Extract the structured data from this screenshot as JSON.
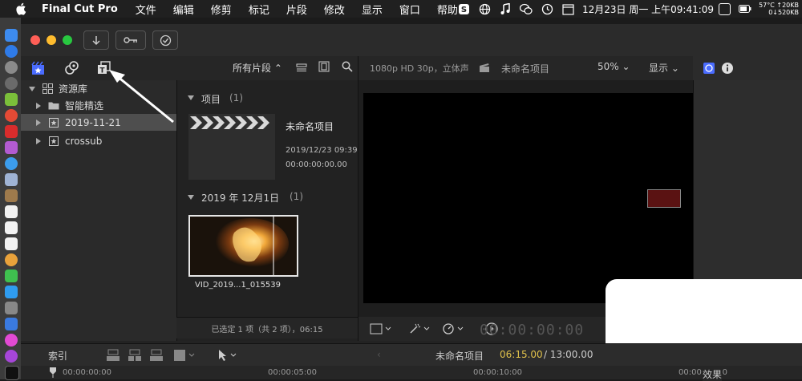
{
  "menubar": {
    "app": "Final Cut Pro",
    "items": [
      "文件",
      "编辑",
      "修剪",
      "标记",
      "片段",
      "修改",
      "显示",
      "窗口",
      "帮助"
    ],
    "clock": "12月23日 周一 上午09:41:09",
    "stats_top": "57°C ↑20KB",
    "stats_bottom": "0↓520KB",
    "icons": [
      "apple-icon",
      "skype-icon",
      "globe-icon",
      "music-icon",
      "wechat-icon",
      "time-machine-icon",
      "calendar-icon",
      "flag-icon",
      "battery-icon"
    ]
  },
  "toolbar": {
    "buttons": [
      "import-icon",
      "key-icon",
      "checkmark-icon"
    ]
  },
  "library_header": {
    "filter_label": "所有片段 ⌃",
    "icons": [
      "libraries-icon",
      "photos-audio-icon",
      "titles-generators-icon"
    ]
  },
  "sidebar": {
    "items": [
      {
        "label": "资源库",
        "expanded": true,
        "indent": 0
      },
      {
        "label": "智能精选",
        "expanded": false,
        "indent": 1
      },
      {
        "label": "2019-11-21",
        "expanded": false,
        "indent": 1,
        "selected": true
      },
      {
        "label": "crossub",
        "expanded": false,
        "indent": 1
      }
    ]
  },
  "browser": {
    "section1": {
      "title": "项目",
      "count": "(1)"
    },
    "project": {
      "name": "未命名项目",
      "date": "2019/12/23 09:39",
      "duration": "00:00:00:00.00"
    },
    "section2": {
      "title": "2019 年 12月1日",
      "count": "(1)"
    },
    "clip": {
      "name": "VID_2019...1_015539"
    },
    "footer": "已选定 1 项（共 2 项），06:15"
  },
  "viewer": {
    "format": "1080p HD 30p，立体声",
    "project_name": "未命名项目",
    "zoom": "50% ⌄",
    "display": "显示 ⌄",
    "timecode": "00:00:00:00"
  },
  "timeline": {
    "index_label": "索引",
    "project_name": "未命名项目",
    "position": "06:15.00",
    "duration": "/ 13:00.00",
    "ruler": [
      "00:00:00:00",
      "00:00:05:00",
      "00:00:10:00",
      "00:00:15:00"
    ],
    "effects_label": "效果"
  },
  "colors": {
    "accent": "#4a6cff",
    "traffic_red": "#ff5f57",
    "traffic_yellow": "#febc2e",
    "traffic_green": "#28c840",
    "timecode_yellow": "#e0c14b"
  }
}
